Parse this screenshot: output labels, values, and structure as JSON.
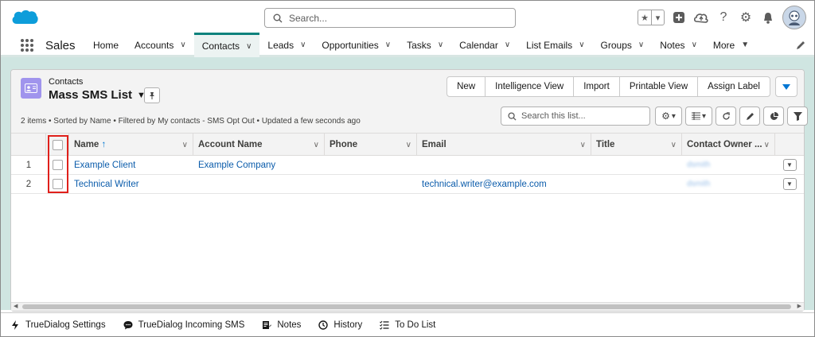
{
  "header": {
    "search_placeholder": "Search..."
  },
  "nav": {
    "app_name": "Sales",
    "items": [
      {
        "label": "Home",
        "has_menu": false
      },
      {
        "label": "Accounts",
        "has_menu": true
      },
      {
        "label": "Contacts",
        "has_menu": true,
        "active": true
      },
      {
        "label": "Leads",
        "has_menu": true
      },
      {
        "label": "Opportunities",
        "has_menu": true
      },
      {
        "label": "Tasks",
        "has_menu": true
      },
      {
        "label": "Calendar",
        "has_menu": true
      },
      {
        "label": "List Emails",
        "has_menu": true
      },
      {
        "label": "Groups",
        "has_menu": true
      },
      {
        "label": "Notes",
        "has_menu": true
      },
      {
        "label": "More",
        "has_menu": true
      }
    ]
  },
  "list": {
    "object_label": "Contacts",
    "title": "Mass SMS List",
    "info": "2 items • Sorted by Name • Filtered by My contacts - SMS Opt Out • Updated a few seconds ago",
    "search_placeholder": "Search this list...",
    "buttons": [
      "New",
      "Intelligence View",
      "Import",
      "Printable View",
      "Assign Label"
    ],
    "columns": [
      "Name",
      "Account Name",
      "Phone",
      "Email",
      "Title",
      "Contact Owner ..."
    ],
    "rows": [
      {
        "num": "1",
        "name": "Example Client",
        "account": "Example Company",
        "phone": "",
        "email": "",
        "title": "",
        "owner": "dsmith"
      },
      {
        "num": "2",
        "name": "Technical Writer",
        "account": "",
        "phone": "",
        "email": "technical.writer@example.com",
        "title": "",
        "owner": "dsmith"
      }
    ]
  },
  "utility_bar": {
    "items": [
      {
        "label": "TrueDialog Settings",
        "icon": "bolt-icon"
      },
      {
        "label": "TrueDialog Incoming SMS",
        "icon": "chat-icon"
      },
      {
        "label": "Notes",
        "icon": "notes-icon"
      },
      {
        "label": "History",
        "icon": "clock-icon"
      },
      {
        "label": "To Do List",
        "icon": "checklist-icon"
      }
    ]
  },
  "colors": {
    "brand": "#0b827c",
    "link": "#0b5cab",
    "highlight": "#e0201b",
    "background": "#cfe5e1",
    "object_icon": "#a094ed"
  }
}
